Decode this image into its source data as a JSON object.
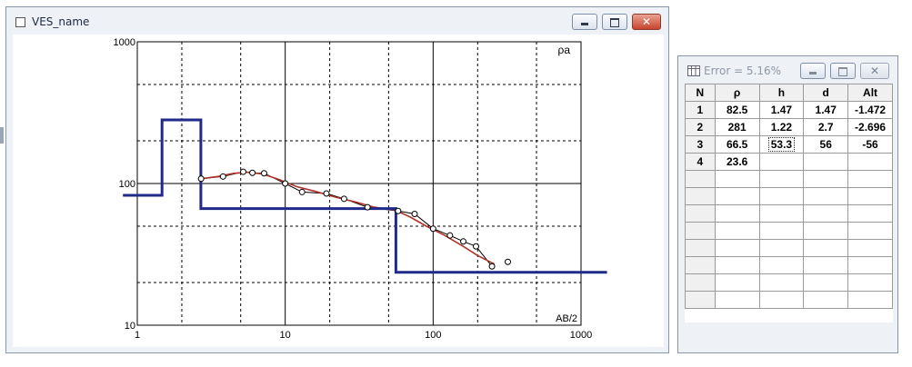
{
  "main_window": {
    "title": "VES_name",
    "controls": {
      "minimize": "minimize",
      "maximize": "maximize",
      "close": "✕"
    }
  },
  "chart_data": {
    "type": "line",
    "xscale": "log",
    "yscale": "log",
    "xlim": [
      1,
      1000
    ],
    "ylim": [
      10,
      1000
    ],
    "x_ticks": [
      "1",
      "10",
      "100",
      "1000"
    ],
    "y_ticks": [
      "10",
      "100",
      "1000"
    ],
    "ylabel_corner": "ρa",
    "xlabel_corner": "AB/2",
    "grid": true,
    "colors": {
      "model": "#1f2a8a",
      "fit": "#b03228",
      "observed": "#000000"
    },
    "series": [
      {
        "kind": "model",
        "points": [
          [
            0.8,
            82.5
          ],
          [
            1.47,
            82.5
          ],
          [
            1.47,
            281
          ],
          [
            2.69,
            281
          ],
          [
            2.69,
            66.5
          ],
          [
            56,
            66.5
          ],
          [
            56,
            23.6
          ],
          [
            1500,
            23.6
          ]
        ]
      },
      {
        "kind": "fit",
        "points": [
          [
            2.7,
            108
          ],
          [
            3.5,
            112
          ],
          [
            4.5,
            118
          ],
          [
            5.5,
            120
          ],
          [
            7,
            117
          ],
          [
            9,
            107
          ],
          [
            12,
            95
          ],
          [
            16,
            88
          ],
          [
            22,
            80
          ],
          [
            30,
            74
          ],
          [
            40,
            68
          ],
          [
            55,
            65
          ],
          [
            70,
            58
          ],
          [
            90,
            50
          ],
          [
            120,
            43
          ],
          [
            160,
            36
          ],
          [
            200,
            31
          ],
          [
            260,
            27
          ]
        ]
      },
      {
        "kind": "observed",
        "points": [
          [
            2.7,
            108
          ],
          [
            3.8,
            112
          ],
          [
            5.2,
            121
          ],
          [
            6,
            119
          ],
          [
            7.2,
            118
          ],
          [
            10,
            100
          ],
          [
            13,
            87
          ],
          [
            19,
            85
          ],
          [
            25,
            78
          ],
          [
            36,
            68
          ],
          [
            58,
            64
          ],
          [
            75,
            61
          ],
          [
            100,
            48
          ],
          [
            130,
            43
          ],
          [
            160,
            39
          ],
          [
            195,
            36
          ],
          [
            250,
            26
          ],
          [
            320,
            28
          ]
        ]
      }
    ]
  },
  "table_window": {
    "title": "Error = 5.16%",
    "controls": {
      "minimize": "minimize",
      "maximize": "maximize",
      "close": "✕"
    },
    "columns": [
      "N",
      "ρ",
      "h",
      "d",
      "Alt"
    ],
    "rows": [
      [
        "1",
        "82.5",
        "1.47",
        "1.47",
        "-1.472"
      ],
      [
        "2",
        "281",
        "1.22",
        "2.7",
        "-2.696"
      ],
      [
        "3",
        "66.5",
        "53.3",
        "56",
        "-56"
      ],
      [
        "4",
        "23.6",
        "",
        "",
        ""
      ],
      [
        "",
        "",
        "",
        "",
        ""
      ],
      [
        "",
        "",
        "",
        "",
        ""
      ],
      [
        "",
        "",
        "",
        "",
        ""
      ],
      [
        "",
        "",
        "",
        "",
        ""
      ],
      [
        "",
        "",
        "",
        "",
        ""
      ],
      [
        "",
        "",
        "",
        "",
        ""
      ],
      [
        "",
        "",
        "",
        "",
        ""
      ],
      [
        "",
        "",
        "",
        "",
        ""
      ]
    ],
    "selected_cell": {
      "row": 2,
      "col": 2
    }
  }
}
